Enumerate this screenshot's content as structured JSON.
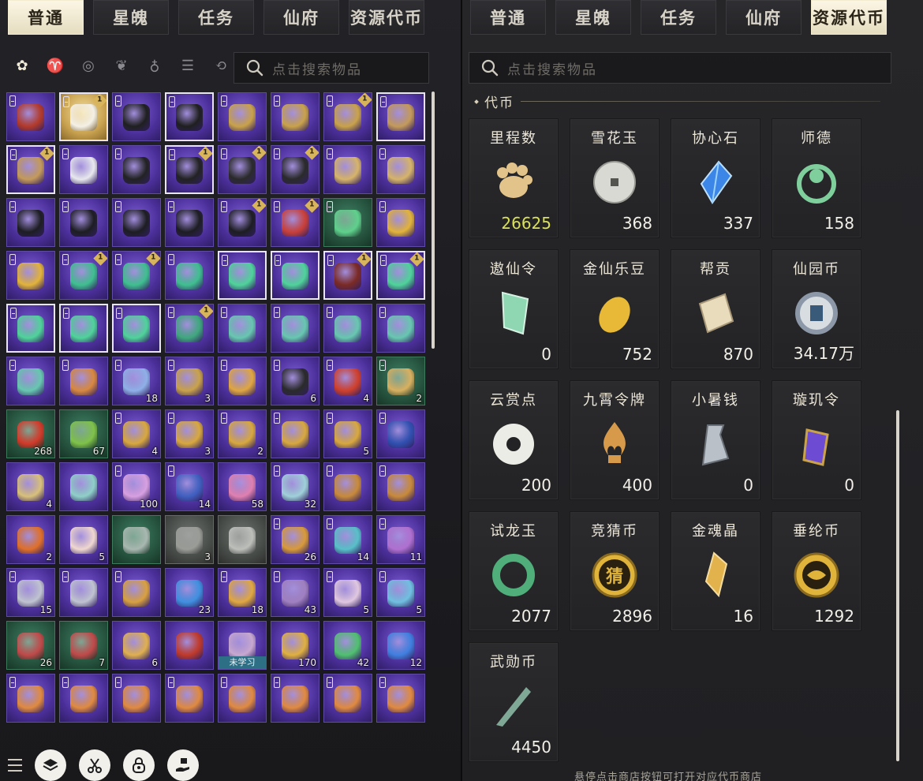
{
  "left": {
    "tabs": [
      {
        "label": "普通",
        "active": true
      },
      {
        "label": "星魄",
        "active": false
      },
      {
        "label": "任务",
        "active": false
      },
      {
        "label": "仙府",
        "active": false
      },
      {
        "label": "资源代币",
        "active": false
      }
    ],
    "filters": [
      {
        "icon": "all-items-icon",
        "active": true
      },
      {
        "icon": "clothing-icon",
        "active": false
      },
      {
        "icon": "accessory-icon",
        "active": false
      },
      {
        "icon": "material-icon",
        "active": false
      },
      {
        "icon": "potion-icon",
        "active": false
      },
      {
        "icon": "misc-icon",
        "active": false
      },
      {
        "icon": "refresh-icon",
        "active": false
      }
    ],
    "search_placeholder": "点击搜索物品",
    "items": [
      {
        "bg": "purple",
        "lock": true,
        "badge": "",
        "qty": "",
        "art": "#b33a2a"
      },
      {
        "bg": "gold",
        "lock": true,
        "badge": "1",
        "qty": "",
        "art": "#f4f0e6",
        "sel": true
      },
      {
        "bg": "purple",
        "lock": true,
        "badge": "",
        "qty": "",
        "art": "#1f1f1f"
      },
      {
        "bg": "purple",
        "lock": true,
        "badge": "",
        "qty": "",
        "art": "#1f1f1f",
        "sel": true
      },
      {
        "bg": "purple",
        "lock": true,
        "badge": "",
        "qty": "",
        "art": "#c9a24a"
      },
      {
        "bg": "purple",
        "lock": true,
        "badge": "",
        "qty": "",
        "art": "#c9a24a"
      },
      {
        "bg": "purple",
        "lock": true,
        "badge": "1",
        "qty": "",
        "art": "#c9a24a"
      },
      {
        "bg": "purple",
        "lock": true,
        "badge": "",
        "qty": "",
        "art": "#c49a5a",
        "sel": true
      },
      {
        "bg": "purple",
        "lock": true,
        "badge": "1",
        "qty": "",
        "art": "#c49a5a",
        "sel": true
      },
      {
        "bg": "purple",
        "lock": true,
        "badge": "",
        "qty": "",
        "art": "#e8e8ee"
      },
      {
        "bg": "purple",
        "lock": true,
        "badge": "",
        "qty": "",
        "art": "#222222"
      },
      {
        "bg": "purple",
        "lock": true,
        "badge": "1",
        "qty": "",
        "art": "#222222",
        "sel": true
      },
      {
        "bg": "purple",
        "lock": true,
        "badge": "1",
        "qty": "",
        "art": "#2a2a2a"
      },
      {
        "bg": "purple",
        "lock": true,
        "badge": "1",
        "qty": "",
        "art": "#2a2a2a"
      },
      {
        "bg": "purple",
        "lock": true,
        "badge": "",
        "qty": "",
        "art": "#d6b46a"
      },
      {
        "bg": "purple",
        "lock": true,
        "badge": "",
        "qty": "",
        "art": "#d6b46a"
      },
      {
        "bg": "purple",
        "lock": true,
        "badge": "",
        "qty": "",
        "art": "#1d1d22"
      },
      {
        "bg": "purple",
        "lock": true,
        "badge": "",
        "qty": "",
        "art": "#1d1d22"
      },
      {
        "bg": "purple",
        "lock": true,
        "badge": "",
        "qty": "",
        "art": "#1d1d22"
      },
      {
        "bg": "purple",
        "lock": true,
        "badge": "",
        "qty": "",
        "art": "#1d1d22"
      },
      {
        "bg": "purple",
        "lock": true,
        "badge": "1",
        "qty": "",
        "art": "#1d1d22"
      },
      {
        "bg": "purple",
        "lock": true,
        "badge": "1",
        "qty": "",
        "art": "#c9403a"
      },
      {
        "bg": "green",
        "lock": true,
        "badge": "",
        "qty": "",
        "art": "#5fd08c"
      },
      {
        "bg": "purple",
        "lock": true,
        "badge": "",
        "qty": "",
        "art": "#e2b33a"
      },
      {
        "bg": "purple",
        "lock": true,
        "badge": "",
        "qty": "",
        "art": "#e2b33a"
      },
      {
        "bg": "purple",
        "lock": true,
        "badge": "1",
        "qty": "",
        "art": "#3fbf8f"
      },
      {
        "bg": "purple",
        "lock": true,
        "badge": "1",
        "qty": "",
        "art": "#3fbf8f"
      },
      {
        "bg": "purple",
        "lock": true,
        "badge": "",
        "qty": "",
        "art": "#3fbf8f"
      },
      {
        "bg": "purple",
        "lock": true,
        "badge": "",
        "qty": "",
        "art": "#4fd39a",
        "sel": true
      },
      {
        "bg": "purple",
        "lock": true,
        "badge": "",
        "qty": "",
        "art": "#4fd39a",
        "sel": true
      },
      {
        "bg": "purple",
        "lock": true,
        "badge": "1",
        "qty": "",
        "art": "#7b2a24",
        "sel": true
      },
      {
        "bg": "purple",
        "lock": true,
        "badge": "1",
        "qty": "",
        "art": "#4fd39a",
        "sel": true
      },
      {
        "bg": "purple",
        "lock": true,
        "badge": "",
        "qty": "",
        "art": "#4fd39a",
        "sel": true
      },
      {
        "bg": "purple",
        "lock": true,
        "badge": "",
        "qty": "",
        "art": "#4fd39a",
        "sel": true
      },
      {
        "bg": "purple",
        "lock": true,
        "badge": "",
        "qty": "",
        "art": "#4fd39a",
        "sel": true
      },
      {
        "bg": "purple",
        "lock": true,
        "badge": "1",
        "qty": "",
        "art": "#3fa87e"
      },
      {
        "bg": "purple",
        "lock": true,
        "badge": "",
        "qty": "",
        "art": "#67c7b0"
      },
      {
        "bg": "purple",
        "lock": true,
        "badge": "",
        "qty": "",
        "art": "#67c7b0"
      },
      {
        "bg": "purple",
        "lock": true,
        "badge": "",
        "qty": "",
        "art": "#67c7b0"
      },
      {
        "bg": "purple",
        "lock": true,
        "badge": "",
        "qty": "",
        "art": "#67c7b0"
      },
      {
        "bg": "purple",
        "lock": true,
        "badge": "",
        "qty": "",
        "art": "#67c7b0"
      },
      {
        "bg": "purple",
        "lock": true,
        "badge": "",
        "qty": "",
        "art": "#d8893f"
      },
      {
        "bg": "purple",
        "lock": true,
        "badge": "",
        "qty": "18",
        "art": "#8fb0e8"
      },
      {
        "bg": "purple",
        "lock": true,
        "badge": "",
        "qty": "3",
        "art": "#c9a24a"
      },
      {
        "bg": "purple",
        "lock": true,
        "badge": "",
        "qty": "",
        "art": "#e0a640"
      },
      {
        "bg": "purple",
        "lock": true,
        "badge": "",
        "qty": "6",
        "art": "#2a2a2a"
      },
      {
        "bg": "purple",
        "lock": true,
        "badge": "",
        "qty": "4",
        "art": "#d0402c"
      },
      {
        "bg": "green",
        "lock": true,
        "badge": "",
        "qty": "2",
        "art": "#d8b060"
      },
      {
        "bg": "green",
        "lock": false,
        "badge": "",
        "qty": "268",
        "art": "#d23a2a"
      },
      {
        "bg": "green",
        "lock": false,
        "badge": "",
        "qty": "67",
        "art": "#7fc24a"
      },
      {
        "bg": "purple",
        "lock": true,
        "badge": "",
        "qty": "4",
        "art": "#d8a83e"
      },
      {
        "bg": "purple",
        "lock": true,
        "badge": "",
        "qty": "3",
        "art": "#d8a83e"
      },
      {
        "bg": "purple",
        "lock": true,
        "badge": "",
        "qty": "2",
        "art": "#d8a83e"
      },
      {
        "bg": "purple",
        "lock": true,
        "badge": "",
        "qty": "",
        "art": "#d8a83e"
      },
      {
        "bg": "purple",
        "lock": true,
        "badge": "",
        "qty": "5",
        "art": "#d8a83e"
      },
      {
        "bg": "purple",
        "lock": true,
        "badge": "",
        "qty": "",
        "art": "#3050b0"
      },
      {
        "bg": "purple",
        "lock": false,
        "badge": "",
        "qty": "4",
        "art": "#d8c07a"
      },
      {
        "bg": "purple",
        "lock": false,
        "badge": "",
        "qty": "",
        "art": "#8fd0c8"
      },
      {
        "bg": "purple",
        "lock": true,
        "badge": "",
        "qty": "100",
        "art": "#d8a0e0"
      },
      {
        "bg": "purple",
        "lock": true,
        "badge": "",
        "qty": "14",
        "art": "#4060c0"
      },
      {
        "bg": "purple",
        "lock": false,
        "badge": "",
        "qty": "58",
        "art": "#e080b0"
      },
      {
        "bg": "purple",
        "lock": true,
        "badge": "",
        "qty": "32",
        "art": "#9fd0d8"
      },
      {
        "bg": "purple",
        "lock": true,
        "badge": "",
        "qty": "",
        "art": "#c88a3a"
      },
      {
        "bg": "purple",
        "lock": true,
        "badge": "",
        "qty": "",
        "art": "#c88a3a"
      },
      {
        "bg": "purple",
        "lock": false,
        "badge": "",
        "qty": "2",
        "art": "#e0702a"
      },
      {
        "bg": "purple",
        "lock": false,
        "badge": "",
        "qty": "5",
        "art": "#f0d8d0"
      },
      {
        "bg": "green",
        "lock": false,
        "badge": "",
        "qty": "",
        "art": "#a8b8b0"
      },
      {
        "bg": "gray",
        "lock": false,
        "badge": "",
        "qty": "3",
        "art": "#9a9c98"
      },
      {
        "bg": "gray",
        "lock": false,
        "badge": "",
        "qty": "",
        "art": "#bdbfbb"
      },
      {
        "bg": "purple",
        "lock": true,
        "badge": "",
        "qty": "26",
        "art": "#d89a3a"
      },
      {
        "bg": "purple",
        "lock": true,
        "badge": "",
        "qty": "14",
        "art": "#58c0c8"
      },
      {
        "bg": "purple",
        "lock": true,
        "badge": "",
        "qty": "11",
        "art": "#b070d0"
      },
      {
        "bg": "purple",
        "lock": true,
        "badge": "",
        "qty": "15",
        "art": "#c0c4d0"
      },
      {
        "bg": "purple",
        "lock": true,
        "badge": "",
        "qty": "",
        "art": "#c0c4d0"
      },
      {
        "bg": "purple",
        "lock": true,
        "badge": "",
        "qty": "",
        "art": "#d8a040"
      },
      {
        "bg": "purple",
        "lock": false,
        "badge": "",
        "qty": "23",
        "art": "#4090e0"
      },
      {
        "bg": "purple",
        "lock": true,
        "badge": "",
        "qty": "18",
        "art": "#e0a840"
      },
      {
        "bg": "purple",
        "lock": true,
        "badge": "",
        "qty": "43",
        "art": "#a080c0"
      },
      {
        "bg": "purple",
        "lock": true,
        "badge": "",
        "qty": "5",
        "art": "#e0c8e0"
      },
      {
        "bg": "purple",
        "lock": true,
        "badge": "",
        "qty": "5",
        "art": "#70c0e0"
      },
      {
        "bg": "green",
        "lock": false,
        "badge": "",
        "qty": "26",
        "art": "#c04a4a"
      },
      {
        "bg": "green",
        "lock": false,
        "badge": "",
        "qty": "7",
        "art": "#c04a4a"
      },
      {
        "bg": "purple",
        "lock": false,
        "badge": "",
        "qty": "6",
        "art": "#e0b050"
      },
      {
        "bg": "purple",
        "lock": false,
        "badge": "",
        "qty": "",
        "art": "#c03a2a"
      },
      {
        "bg": "purple",
        "lock": false,
        "badge": "",
        "qty": "",
        "art": "#c8a8d0",
        "unlearned": "未学习"
      },
      {
        "bg": "purple",
        "lock": false,
        "badge": "",
        "qty": "170",
        "art": "#e0b040"
      },
      {
        "bg": "purple",
        "lock": false,
        "badge": "",
        "qty": "42",
        "art": "#50c070"
      },
      {
        "bg": "purple",
        "lock": false,
        "badge": "",
        "qty": "12",
        "art": "#4080e0"
      },
      {
        "bg": "purple",
        "lock": true,
        "badge": "",
        "qty": "",
        "art": "#e08a40"
      },
      {
        "bg": "purple",
        "lock": true,
        "badge": "",
        "qty": "",
        "art": "#e08a40"
      },
      {
        "bg": "purple",
        "lock": true,
        "badge": "",
        "qty": "",
        "art": "#e08a40"
      },
      {
        "bg": "purple",
        "lock": true,
        "badge": "",
        "qty": "",
        "art": "#e08a40"
      },
      {
        "bg": "purple",
        "lock": true,
        "badge": "",
        "qty": "",
        "art": "#e08a40"
      },
      {
        "bg": "purple",
        "lock": true,
        "badge": "",
        "qty": "",
        "art": "#e08a40"
      },
      {
        "bg": "purple",
        "lock": true,
        "badge": "",
        "qty": "",
        "art": "#e08a40"
      },
      {
        "bg": "purple",
        "lock": true,
        "badge": "",
        "qty": "",
        "art": "#e08a40"
      }
    ],
    "bottom_buttons": [
      "layers-icon",
      "scissors-icon",
      "lock-bag-icon",
      "hand-gift-icon"
    ]
  },
  "right": {
    "tabs": [
      {
        "label": "普通",
        "active": false
      },
      {
        "label": "星魄",
        "active": false
      },
      {
        "label": "任务",
        "active": false
      },
      {
        "label": "仙府",
        "active": false
      },
      {
        "label": "资源代币",
        "active": true
      }
    ],
    "search_placeholder": "点击搜索物品",
    "section_title": "代币",
    "currencies": [
      {
        "name": "里程数",
        "amount": "26625",
        "highlight": true,
        "icon": "paw-icon",
        "color": "#e2c48a"
      },
      {
        "name": "雪花玉",
        "amount": "368",
        "icon": "jade-coin-icon",
        "color": "#d9d9d4"
      },
      {
        "name": "协心石",
        "amount": "337",
        "icon": "blue-crystal-icon",
        "color": "#3b86e6"
      },
      {
        "name": "师德",
        "amount": "158",
        "icon": "green-emblem-icon",
        "color": "#7fcf9d"
      },
      {
        "name": "遨仙令",
        "amount": "0",
        "icon": "green-token-icon",
        "color": "#8fd6b3"
      },
      {
        "name": "金仙乐豆",
        "amount": "752",
        "icon": "gold-bean-icon",
        "color": "#e7b936"
      },
      {
        "name": "帮贡",
        "amount": "870",
        "icon": "scroll-badge-icon",
        "color": "#e8dcbc"
      },
      {
        "name": "仙园币",
        "amount": "34.17万",
        "icon": "garden-coin-icon",
        "color": "#8c98a8"
      },
      {
        "name": "云赏点",
        "amount": "200",
        "icon": "white-ring-icon",
        "color": "#ecece6"
      },
      {
        "name": "九霄令牌",
        "amount": "400",
        "icon": "flame-token-icon",
        "color": "#d79a4a"
      },
      {
        "name": "小暑钱",
        "amount": "0",
        "icon": "spade-coin-icon",
        "color": "#b9c0c8"
      },
      {
        "name": "璇玑令",
        "amount": "0",
        "icon": "purple-gem-token-icon",
        "color": "#6d4bd3"
      },
      {
        "name": "试龙玉",
        "amount": "2077",
        "icon": "dragon-jade-icon",
        "color": "#4fae7a"
      },
      {
        "name": "竞猜币",
        "amount": "2896",
        "icon": "guess-coin-icon",
        "color": "#e0b43a",
        "glyph": "猜"
      },
      {
        "name": "金魂晶",
        "amount": "16",
        "icon": "gold-crystal-icon",
        "color": "#e2b24c"
      },
      {
        "name": "垂纶币",
        "amount": "1292",
        "icon": "fish-coin-icon",
        "color": "#e0b43a"
      },
      {
        "name": "武勋币",
        "amount": "4450",
        "icon": "blade-icon",
        "color": "#7fa896"
      }
    ],
    "hint": "悬停点击商店按钮可打开对应代币商店"
  }
}
